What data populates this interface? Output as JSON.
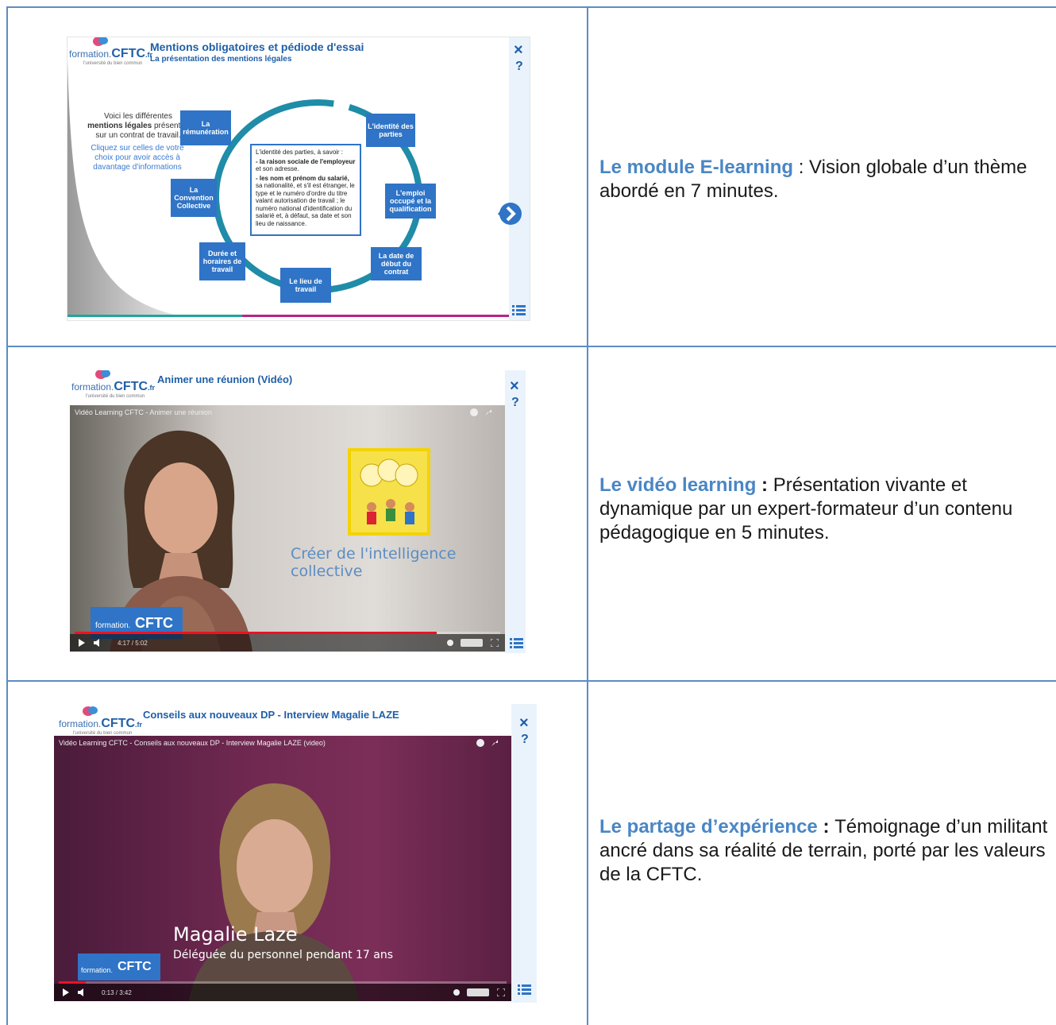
{
  "rows": [
    {
      "module": {
        "title": "Mentions obligatoires et pédiode d'essai",
        "subtitle": "La présentation des mentions légales",
        "intro_line1": "Voici les différentes",
        "intro_bold": "mentions légales",
        "intro_line2": "présentes",
        "intro_line3": "sur un contrat de travail.",
        "intro_link": "Cliquez sur celles de votre choix pour avoir accès à davantage d'informations",
        "boxes": [
          "La rémunération",
          "L'identité des parties",
          "La Convention Collective",
          "L'emploi occupé et la qualification",
          "Durée et horaires de travail",
          "La date de début du contrat",
          "Le lieu de travail"
        ],
        "popup_head": "L'identité des parties, à savoir :",
        "popup_b1": "- la raison sociale de l'employeur",
        "popup_t1": "et son adresse.",
        "popup_b2": "- les nom et prénom du salarié,",
        "popup_t2": "sa nationalité, et s'il est étranger, le type et le numéro d'ordre du titre valant autorisation de travail ; le numéro national d'identification du salarié et, à défaut, sa date et son lieu de naissance."
      },
      "text_highlight": "Le module E-learning",
      "text_sep": " : ",
      "text_body": "Vision globale d’un thème abordé en 7 minutes."
    },
    {
      "module": {
        "title": "Animer une réunion (Vidéo)",
        "video_title": "Vidéo Learning CFTC - Animer une réunion",
        "slide_text": "Créer de l'intelligence collective",
        "time": "4:17 / 5:02",
        "progress": 0.85
      },
      "text_highlight": "Le vidéo learning",
      "text_sep": " : ",
      "text_body": "Présentation vivante et dynamique par un expert-formateur d’un contenu pédagogique en 5 minutes."
    },
    {
      "module": {
        "title": "Conseils aux nouveaux DP - Interview Magalie LAZE",
        "video_title": "Vidéo Learning CFTC - Conseils aux nouveaux DP - Interview Magalie LAZE (video)",
        "name": "Magalie Laze",
        "role": "Déléguée du personnel pendant 17 ans",
        "time": "0:13 / 3:42",
        "progress": 0.06
      },
      "text_highlight": "Le partage d’expérience",
      "text_sep": " : ",
      "text_body": "Témoignage d’un militant ancré dans sa réalité de terrain, porté par les valeurs de la CFTC."
    }
  ],
  "logo": {
    "formation": "formation.",
    "cftc": "CFTC",
    "fr": ".fr",
    "tagline": "l'université du bien commun"
  },
  "buttons": {
    "close": "×",
    "help": "?"
  },
  "colors": {
    "accent": "#4a86c5",
    "border": "#5b8dc4",
    "box": "#2f74c6"
  }
}
